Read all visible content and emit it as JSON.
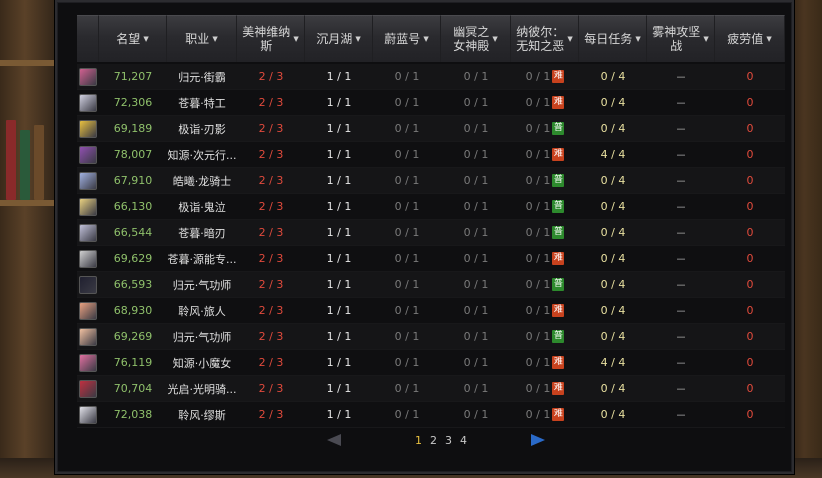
{
  "header": {
    "columns": [
      {
        "key": "avatar",
        "label": "",
        "sort": false
      },
      {
        "key": "fame",
        "label": "名望",
        "sort": true
      },
      {
        "key": "job",
        "label": "职业",
        "sort": true
      },
      {
        "key": "c1",
        "label": "美神维纳\n斯",
        "sort": true
      },
      {
        "key": "c2",
        "label": "沉月湖",
        "sort": true
      },
      {
        "key": "c3",
        "label": "蔚蓝号",
        "sort": true
      },
      {
        "key": "c4",
        "label": "幽冥之\n女神殿",
        "sort": true
      },
      {
        "key": "c5",
        "label": "纳彼尔：\n无知之恶",
        "sort": true
      },
      {
        "key": "c6",
        "label": "每日任务",
        "sort": true
      },
      {
        "key": "c7",
        "label": "雾神攻坚\n战",
        "sort": true
      },
      {
        "key": "c8",
        "label": "疲劳值",
        "sort": true
      }
    ]
  },
  "badges": {
    "hard": "难",
    "normal": "普"
  },
  "avatar_colors": [
    "#d06090",
    "#d0d0e0",
    "#e8c040",
    "#9050b0",
    "#a0b0e0",
    "#e8d080",
    "#c0c0d8",
    "#d0d0d0",
    "#202030",
    "#e8a080",
    "#f0c0a0",
    "#e070a0",
    "#c03040",
    "#e0e0e8"
  ],
  "rows": [
    {
      "fame": "71,207",
      "job": "归元·街霸",
      "c1": "2 / 3",
      "c2": "1 / 1",
      "c3": "0 / 1",
      "c4": "0 / 1",
      "c5": "0 / 1",
      "badge": "hard",
      "c6": "0 / 4",
      "c7": "－",
      "c8": "0"
    },
    {
      "fame": "72,306",
      "job": "苍暮·特工",
      "c1": "2 / 3",
      "c2": "1 / 1",
      "c3": "0 / 1",
      "c4": "0 / 1",
      "c5": "0 / 1",
      "badge": "hard",
      "c6": "0 / 4",
      "c7": "－",
      "c8": "0"
    },
    {
      "fame": "69,189",
      "job": "极诣·刃影",
      "c1": "2 / 3",
      "c2": "1 / 1",
      "c3": "0 / 1",
      "c4": "0 / 1",
      "c5": "0 / 1",
      "badge": "normal",
      "c6": "0 / 4",
      "c7": "－",
      "c8": "0"
    },
    {
      "fame": "78,007",
      "job": "知源·次元行...",
      "c1": "2 / 3",
      "c2": "1 / 1",
      "c3": "0 / 1",
      "c4": "0 / 1",
      "c5": "0 / 1",
      "badge": "hard",
      "c6": "4 / 4",
      "c7": "－",
      "c8": "0"
    },
    {
      "fame": "67,910",
      "job": "皓曦·龙骑士",
      "c1": "2 / 3",
      "c2": "1 / 1",
      "c3": "0 / 1",
      "c4": "0 / 1",
      "c5": "0 / 1",
      "badge": "normal",
      "c6": "0 / 4",
      "c7": "－",
      "c8": "0"
    },
    {
      "fame": "66,130",
      "job": "极诣·鬼泣",
      "c1": "2 / 3",
      "c2": "1 / 1",
      "c3": "0 / 1",
      "c4": "0 / 1",
      "c5": "0 / 1",
      "badge": "normal",
      "c6": "0 / 4",
      "c7": "－",
      "c8": "0"
    },
    {
      "fame": "66,544",
      "job": "苍暮·暗刃",
      "c1": "2 / 3",
      "c2": "1 / 1",
      "c3": "0 / 1",
      "c4": "0 / 1",
      "c5": "0 / 1",
      "badge": "normal",
      "c6": "0 / 4",
      "c7": "－",
      "c8": "0"
    },
    {
      "fame": "69,629",
      "job": "苍暮·源能专...",
      "c1": "2 / 3",
      "c2": "1 / 1",
      "c3": "0 / 1",
      "c4": "0 / 1",
      "c5": "0 / 1",
      "badge": "hard",
      "c6": "0 / 4",
      "c7": "－",
      "c8": "0"
    },
    {
      "fame": "66,593",
      "job": "归元·气功师",
      "c1": "2 / 3",
      "c2": "1 / 1",
      "c3": "0 / 1",
      "c4": "0 / 1",
      "c5": "0 / 1",
      "badge": "normal",
      "c6": "0 / 4",
      "c7": "－",
      "c8": "0"
    },
    {
      "fame": "68,930",
      "job": "聆风·旅人",
      "c1": "2 / 3",
      "c2": "1 / 1",
      "c3": "0 / 1",
      "c4": "0 / 1",
      "c5": "0 / 1",
      "badge": "hard",
      "c6": "0 / 4",
      "c7": "－",
      "c8": "0"
    },
    {
      "fame": "69,269",
      "job": "归元·气功师",
      "c1": "2 / 3",
      "c2": "1 / 1",
      "c3": "0 / 1",
      "c4": "0 / 1",
      "c5": "0 / 1",
      "badge": "normal",
      "c6": "0 / 4",
      "c7": "－",
      "c8": "0"
    },
    {
      "fame": "76,119",
      "job": "知源·小魔女",
      "c1": "2 / 3",
      "c2": "1 / 1",
      "c3": "0 / 1",
      "c4": "0 / 1",
      "c5": "0 / 1",
      "badge": "hard",
      "c6": "4 / 4",
      "c7": "－",
      "c8": "0"
    },
    {
      "fame": "70,704",
      "job": "光启·光明骑...",
      "c1": "2 / 3",
      "c2": "1 / 1",
      "c3": "0 / 1",
      "c4": "0 / 1",
      "c5": "0 / 1",
      "badge": "hard",
      "c6": "0 / 4",
      "c7": "－",
      "c8": "0"
    },
    {
      "fame": "72,038",
      "job": "聆风·缪斯",
      "c1": "2 / 3",
      "c2": "1 / 1",
      "c3": "0 / 1",
      "c4": "0 / 1",
      "c5": "0 / 1",
      "badge": "hard",
      "c6": "0 / 4",
      "c7": "－",
      "c8": "0"
    }
  ],
  "pager": {
    "pages": [
      "1",
      "2",
      "3",
      "4"
    ],
    "current": "1"
  }
}
